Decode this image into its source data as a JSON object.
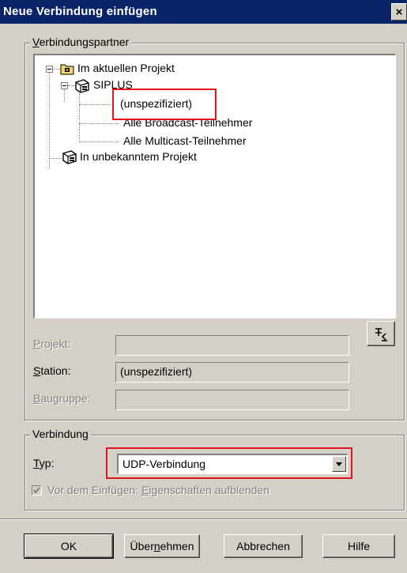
{
  "window": {
    "title": "Neue Verbindung einfügen",
    "close_glyph": "×"
  },
  "partner_group": {
    "legend_prefix": "",
    "legend_accel": "V",
    "legend_rest": "erbindungspartner",
    "tree": {
      "project_current": "Im aktuellen Projekt",
      "station": "SIPLUS",
      "unspecified": "(unspezifiziert)",
      "broadcast": "Alle Broadcast-Teilnehmer",
      "multicast": "Alle Multicast-Teilnehmer",
      "project_unknown": "In unbekanntem Projekt"
    },
    "highlight_color": "#e0141e"
  },
  "fields": {
    "projekt": {
      "accel": "P",
      "rest": "rojekt:",
      "value": ""
    },
    "station": {
      "accel": "S",
      "rest": "tation:",
      "value": "(unspezifiziert)"
    },
    "baugruppe": {
      "accel": "B",
      "rest": "augruppe:",
      "value": ""
    }
  },
  "connection_group": {
    "legend": "Verbindung",
    "type_accel": "T",
    "type_rest": "yp:",
    "type_value": "UDP-Verbindung",
    "checkbox_label_1": "Vor dem Einfügen: ",
    "checkbox_accel": "E",
    "checkbox_label_2": "igenschaften aufblenden",
    "checkbox_checked": true
  },
  "buttons": {
    "ok": "OK",
    "apply_pre": "Über",
    "apply_accel": "n",
    "apply_post": "ehmen",
    "cancel": "Abbrechen",
    "help": "Hilfe"
  }
}
